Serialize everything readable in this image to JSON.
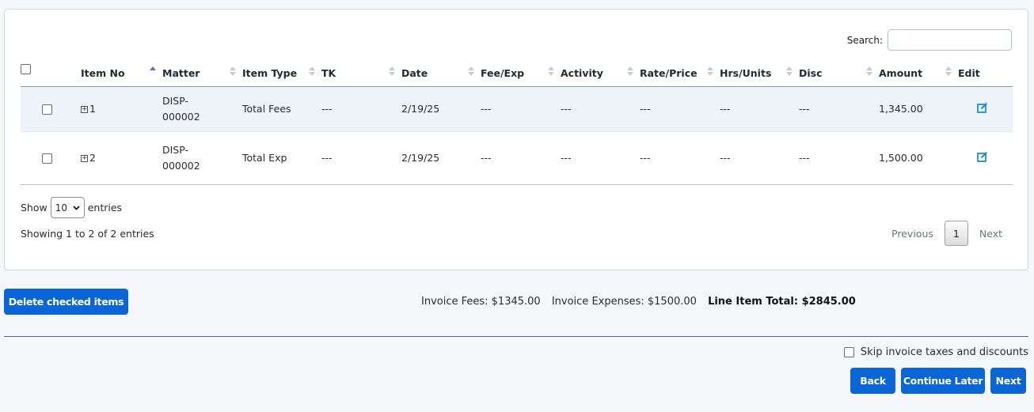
{
  "search": {
    "label": "Search:",
    "value": ""
  },
  "table": {
    "headers": [
      "Item No",
      "Matter",
      "Item Type",
      "TK",
      "Date",
      "Fee/Exp",
      "Activity",
      "Rate/Price",
      "Hrs/Units",
      "Disc",
      "Amount",
      "Edit"
    ],
    "rows": [
      {
        "item_no": "1",
        "matter_line1": "DISP-",
        "matter_line2": "000002",
        "item_type": "Total Fees",
        "tk": "---",
        "date": "2/19/25",
        "fee_exp": "---",
        "activity": "---",
        "rate": "---",
        "hrs": "---",
        "disc": "---",
        "amount": "1,345.00"
      },
      {
        "item_no": "2",
        "matter_line1": "DISP-",
        "matter_line2": "000002",
        "item_type": "Total Exp",
        "tk": "---",
        "date": "2/19/25",
        "fee_exp": "---",
        "activity": "---",
        "rate": "---",
        "hrs": "---",
        "disc": "---",
        "amount": "1,500.00"
      }
    ]
  },
  "length": {
    "show": "Show",
    "value": "10",
    "entries": "entries"
  },
  "info": "Showing 1 to 2 of 2 entries",
  "pager": {
    "previous": "Previous",
    "current": "1",
    "next": "Next"
  },
  "actions": {
    "delete_checked": "Delete checked items"
  },
  "totals": {
    "fees": "Invoice Fees: $1345.00",
    "expenses": "Invoice Expenses: $1500.00",
    "line_total": "Line Item Total: $2845.00"
  },
  "skip_label": "Skip invoice taxes and discounts",
  "footer": {
    "back": "Back",
    "continue_later": "Continue Later",
    "next": "Next"
  },
  "colors": {
    "primary": "#0a66d6",
    "row_highlight": "#eef3fa",
    "edit_icon": "#1a8fd6"
  }
}
